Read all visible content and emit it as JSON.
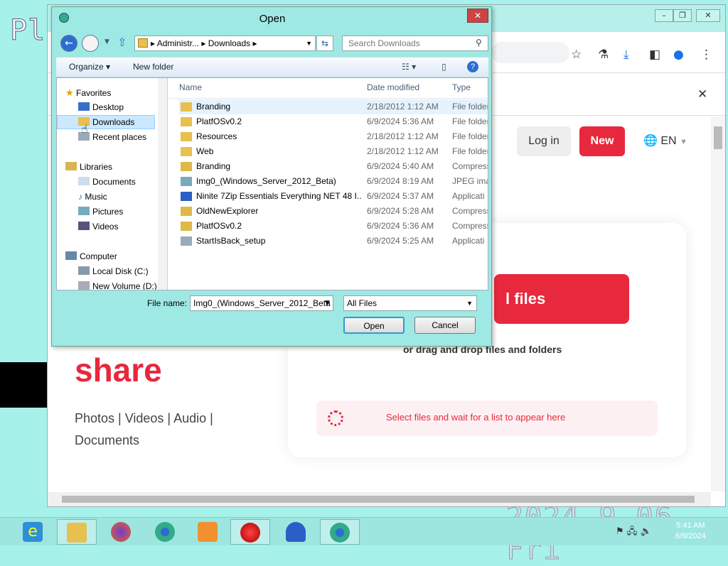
{
  "desktop": {
    "title_fragment": "Pla",
    "bg_clock": "2024.9.06 Fri"
  },
  "browser": {
    "page": {
      "login": "Log in",
      "new": "New",
      "lang": "EN",
      "hero_word": "share",
      "hero_types": "Photos | Videos | Audio | Documents",
      "upload_button": "l files",
      "drag_text": "or drag and drop files and folders",
      "status": "Select files and wait for a list to appear here"
    }
  },
  "dialog": {
    "title": "Open",
    "address": {
      "crumbs": [
        "Administr...",
        "Downloads"
      ]
    },
    "search_placeholder": "Search Downloads",
    "organize": "Organize",
    "new_folder": "New folder",
    "nav": {
      "favorites": "Favorites",
      "desktop": "Desktop",
      "downloads": "Downloads",
      "recent": "Recent places",
      "libraries": "Libraries",
      "documents": "Documents",
      "music": "Music",
      "pictures": "Pictures",
      "videos": "Videos",
      "computer": "Computer",
      "local_disk": "Local Disk (C:)",
      "new_volume": "New Volume (D:)"
    },
    "columns": {
      "name": "Name",
      "date": "Date modified",
      "type": "Type"
    },
    "files": [
      {
        "name": "Branding",
        "date": "2/18/2012 1:12 AM",
        "type": "File folder",
        "icon": "folder"
      },
      {
        "name": "PlatfOSv0.2",
        "date": "6/9/2024 5:36 AM",
        "type": "File folder",
        "icon": "folder"
      },
      {
        "name": "Resources",
        "date": "2/18/2012 1:12 AM",
        "type": "File folder",
        "icon": "folder"
      },
      {
        "name": "Web",
        "date": "2/18/2012 1:12 AM",
        "type": "File folder",
        "icon": "folder"
      },
      {
        "name": "Branding",
        "date": "6/9/2024 5:40 AM",
        "type": "Compress",
        "icon": "zip"
      },
      {
        "name": "Img0_(Windows_Server_2012_Beta)",
        "date": "6/9/2024 8:19 AM",
        "type": "JPEG imag",
        "icon": "image"
      },
      {
        "name": "Ninite 7Zip Essentials Everything NET 48 I...",
        "date": "6/9/2024 5:37 AM",
        "type": "Applicati",
        "icon": "app"
      },
      {
        "name": "OldNewExplorer",
        "date": "6/9/2024 5:28 AM",
        "type": "Compress",
        "icon": "zip"
      },
      {
        "name": "PlatfOSv0.2",
        "date": "6/9/2024 5:36 AM",
        "type": "Compress",
        "icon": "zip"
      },
      {
        "name": "StartIsBack_setup",
        "date": "6/9/2024 5:25 AM",
        "type": "Applicati",
        "icon": "setup"
      }
    ],
    "file_name_label": "File name:",
    "file_name_value": "Img0_(Windows_Server_2012_Beta",
    "file_type": "All Files",
    "open": "Open",
    "cancel": "Cancel"
  },
  "taskbar": {
    "time": "5:41 AM",
    "date": "6/9/2024"
  }
}
